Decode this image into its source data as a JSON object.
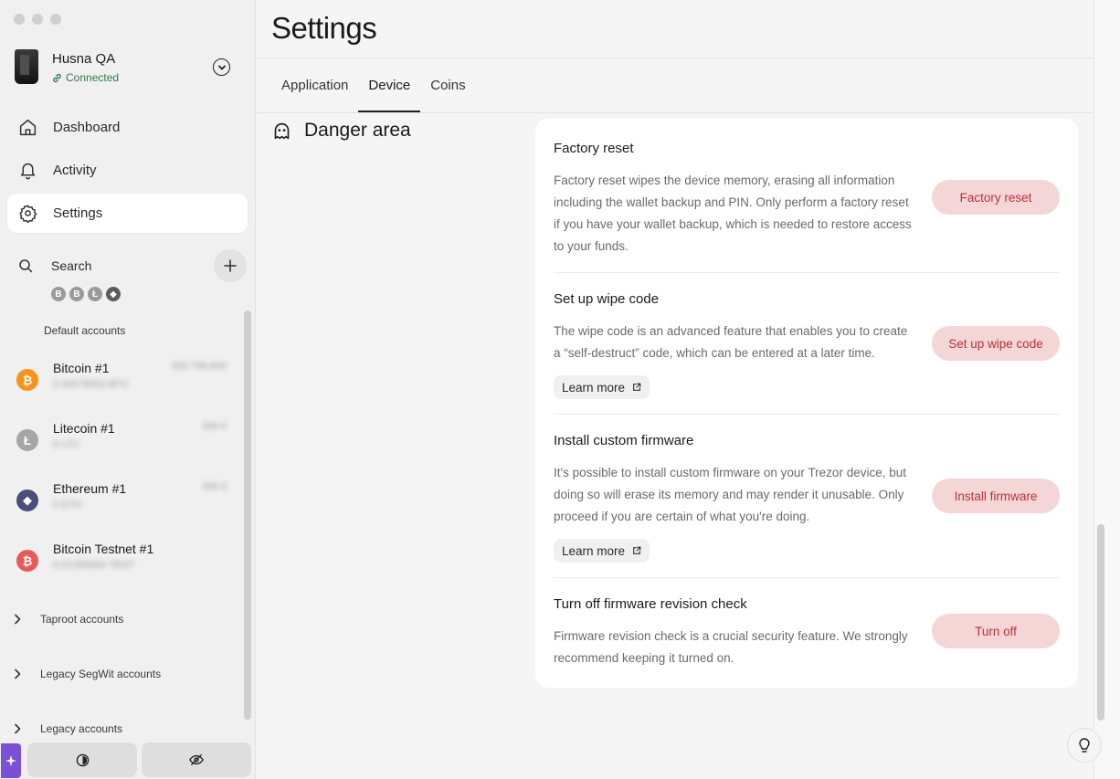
{
  "sidebar": {
    "device": {
      "name": "Husna QA",
      "status": "Connected"
    },
    "nav": [
      {
        "label": "Dashboard",
        "icon": "home-icon"
      },
      {
        "label": "Activity",
        "icon": "bell-icon"
      },
      {
        "label": "Settings",
        "icon": "gear-icon",
        "active": true
      }
    ],
    "search_label": "Search",
    "coin_filter_icons": [
      "B",
      "B",
      "Ł",
      "◆"
    ],
    "default_accounts_label": "Default accounts",
    "accounts": [
      {
        "name": "Bitcoin #1",
        "symbol": "₿",
        "color": "#f7931a",
        "balance": "0.00078053 BTC",
        "fiat": "EM 748.643"
      },
      {
        "name": "Litecoin #1",
        "symbol": "Ł",
        "color": "#a6a6a6",
        "balance": "0 LTC",
        "fiat": "EM 0"
      },
      {
        "name": "Ethereum #1",
        "symbol": "◆",
        "color": "#4a4f7a",
        "balance": "0 ETH",
        "fiat": "EM 0"
      },
      {
        "name": "Bitcoin Testnet #1",
        "symbol": "₿",
        "color": "#e85a5a",
        "balance": "0.01358584 TEST",
        "fiat": ""
      }
    ],
    "groups": [
      "Taproot accounts",
      "Legacy SegWit accounts",
      "Legacy accounts"
    ]
  },
  "main": {
    "title": "Settings",
    "tabs": [
      {
        "label": "Application"
      },
      {
        "label": "Device",
        "active": true
      },
      {
        "label": "Coins"
      }
    ],
    "section_title": "Danger area",
    "rows": [
      {
        "title": "Factory reset",
        "description": "Factory reset wipes the device memory, erasing all information including the wallet backup and PIN. Only perform a factory reset if you have your wallet backup, which is needed to restore access to your funds.",
        "button": "Factory reset"
      },
      {
        "title": "Set up wipe code",
        "description": "The wipe code is an advanced feature that enables you to create a “self-destruct” code, which can be entered at a later time.",
        "button": "Set up wipe code",
        "learn_more": "Learn more"
      },
      {
        "title": "Install custom firmware",
        "description": "It's possible to install custom firmware on your Trezor device, but doing so will erase its memory and may render it unusable. Only proceed if you are certain of what you're doing.",
        "button": "Install firmware",
        "learn_more": "Learn more"
      },
      {
        "title": "Turn off firmware revision check",
        "description": "Firmware revision check is a crucial security feature. We strongly recommend keeping it turned on.",
        "button": "Turn off"
      }
    ]
  },
  "colors": {
    "danger_button_bg": "#f4d6d6",
    "danger_button_text": "#b3343a",
    "connected": "#2f7a4a",
    "magic_accent": "#7b4fd6"
  }
}
